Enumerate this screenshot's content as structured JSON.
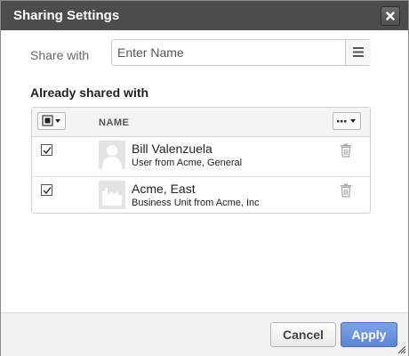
{
  "dialog": {
    "title": "Sharing Settings"
  },
  "share": {
    "label": "Share with",
    "placeholder": "Enter Name",
    "value": ""
  },
  "shared_section": {
    "title": "Already shared with",
    "column_name": "NAME",
    "rows": [
      {
        "name": "Bill Valenzuela",
        "subtitle": "User from Acme, General",
        "checked": true,
        "avatar_icon": "user-silhouette-icon"
      },
      {
        "name": "Acme, East",
        "subtitle": "Business Unit from Acme, Inc",
        "checked": true,
        "avatar_icon": "factory-icon"
      }
    ]
  },
  "footer": {
    "cancel_label": "Cancel",
    "apply_label": "Apply"
  },
  "colors": {
    "titlebar": "#4c4c4c",
    "apply_button": "#5b84d6",
    "body": "#ffffff",
    "footer": "#f2f2f2"
  }
}
